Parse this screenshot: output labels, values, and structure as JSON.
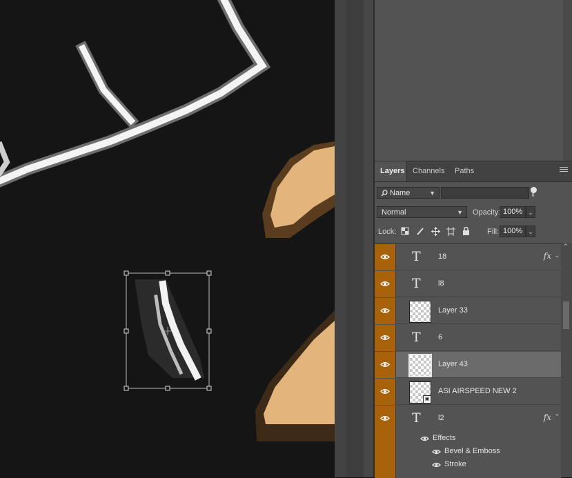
{
  "canvas": {
    "background": "#151515",
    "accent_skin": "#e3b47c"
  },
  "tabs": [
    {
      "label": "Layers",
      "active": true
    },
    {
      "label": "Channels",
      "active": false
    },
    {
      "label": "Paths",
      "active": false
    }
  ],
  "filter": {
    "kind": "Name"
  },
  "blend": {
    "mode": "Normal",
    "opacity_label": "Opacity:",
    "opacity": "100%"
  },
  "lock": {
    "label": "Lock:",
    "fill_label": "Fill:",
    "fill": "100%"
  },
  "layers": [
    {
      "name": "18",
      "kind": "text",
      "fx": "fx"
    },
    {
      "name": "l8",
      "kind": "text"
    },
    {
      "name": "Layer 33",
      "kind": "pixel"
    },
    {
      "name": "6",
      "kind": "text"
    },
    {
      "name": "Layer 43",
      "kind": "pixel",
      "selected": true
    },
    {
      "name": "ASI AIRSPEED NEW 2",
      "kind": "smart"
    },
    {
      "name": "l2",
      "kind": "text",
      "fx": "fx"
    }
  ],
  "effects": {
    "title": "Effects",
    "items": [
      "Bevel & Emboss",
      "Stroke"
    ]
  },
  "colors": {
    "eye_column": "#a8620a",
    "panel": "#535353",
    "selected_row": "#6b6b6b"
  }
}
